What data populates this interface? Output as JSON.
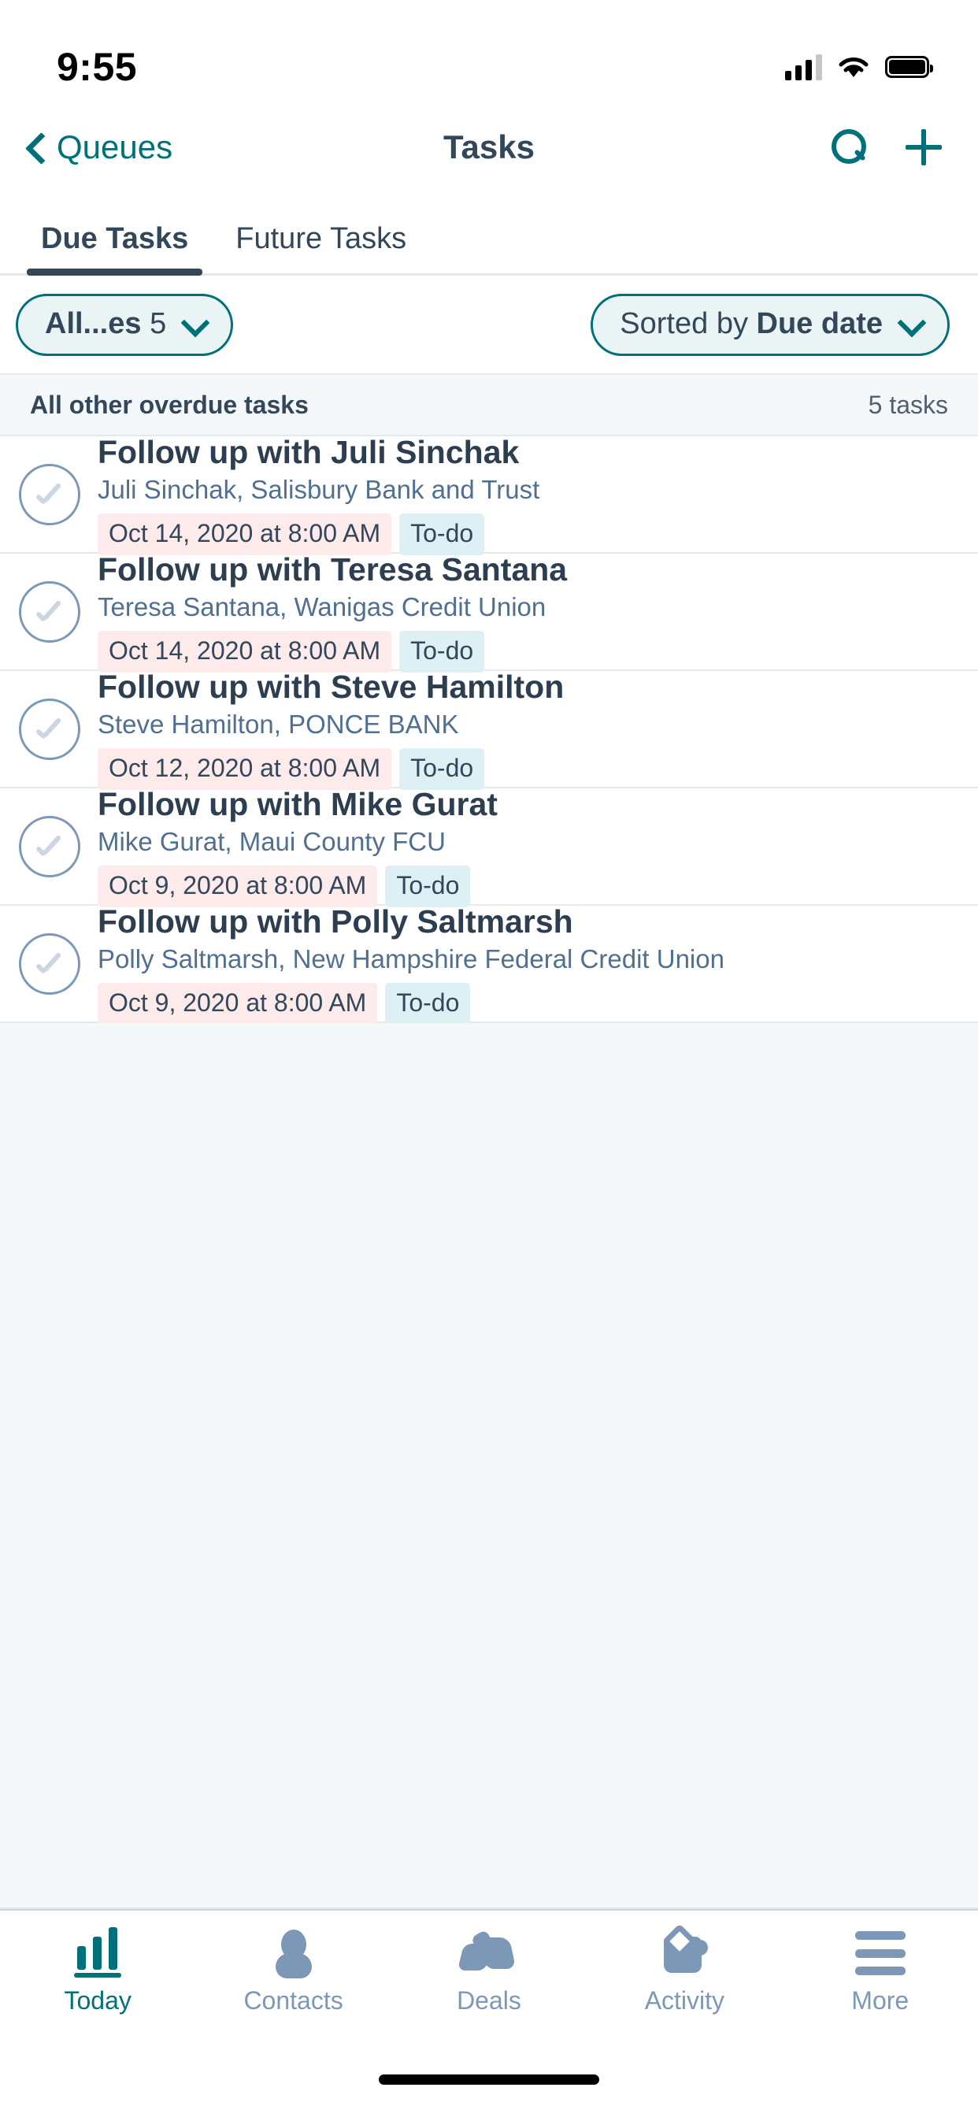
{
  "status_bar": {
    "time": "9:55",
    "cellular_icon": "cellular-signal-icon",
    "wifi_icon": "wifi-icon",
    "battery_icon": "battery-full-icon"
  },
  "nav": {
    "back_label": "Queues",
    "back_icon": "chevron-left-icon",
    "title": "Tasks",
    "search_icon": "search-icon",
    "add_icon": "plus-icon"
  },
  "tabs": [
    {
      "label": "Due Tasks",
      "active": true
    },
    {
      "label": "Future Tasks",
      "active": false
    }
  ],
  "filter_bar": {
    "queue_chip": {
      "label": "All...es",
      "count": "5",
      "chevron_icon": "chevron-down-icon"
    },
    "sort_chip": {
      "prefix": "Sorted by ",
      "value": "Due date",
      "chevron_icon": "chevron-down-icon"
    }
  },
  "section": {
    "title": "All other overdue tasks",
    "count": "5 tasks"
  },
  "tasks": [
    {
      "title": "Follow up with Juli Sinchak",
      "subtitle": "Juli Sinchak, Salisbury Bank and Trust",
      "due": "Oct 14, 2020 at 8:00 AM",
      "type": "To-do",
      "checkbox_icon": "checkmark-circle-icon"
    },
    {
      "title": "Follow up with Teresa Santana",
      "subtitle": "Teresa Santana, Wanigas Credit Union",
      "due": "Oct 14, 2020 at 8:00 AM",
      "type": "To-do",
      "checkbox_icon": "checkmark-circle-icon"
    },
    {
      "title": "Follow up with Steve Hamilton",
      "subtitle": "Steve Hamilton, PONCE BANK",
      "due": "Oct 12, 2020 at 8:00 AM",
      "type": "To-do",
      "checkbox_icon": "checkmark-circle-icon"
    },
    {
      "title": "Follow up with Mike Gurat",
      "subtitle": "Mike Gurat, Maui County FCU",
      "due": "Oct 9, 2020 at 8:00 AM",
      "type": "To-do",
      "checkbox_icon": "checkmark-circle-icon"
    },
    {
      "title": "Follow up with Polly Saltmarsh",
      "subtitle": "Polly Saltmarsh, New Hampshire Federal Credit Union",
      "due": "Oct 9, 2020 at 8:00 AM",
      "type": "To-do",
      "checkbox_icon": "checkmark-circle-icon"
    }
  ],
  "tab_bar": [
    {
      "label": "Today",
      "icon": "bar-chart-icon",
      "active": true
    },
    {
      "label": "Contacts",
      "icon": "person-icon",
      "active": false
    },
    {
      "label": "Deals",
      "icon": "handshake-icon",
      "active": false
    },
    {
      "label": "Activity",
      "icon": "envelope-icon",
      "active": false
    },
    {
      "label": "More",
      "icon": "hamburger-menu-icon",
      "active": false
    }
  ],
  "colors": {
    "accent": "#00707a",
    "text_dark": "#33475b",
    "text_muted": "#516f90",
    "overdue_badge_bg": "#fdeaea",
    "type_badge_bg": "#dff0f5",
    "section_bg": "#f5f8fa",
    "border": "#e5e8ed",
    "inactive_tab_icon": "#7c98b6"
  }
}
